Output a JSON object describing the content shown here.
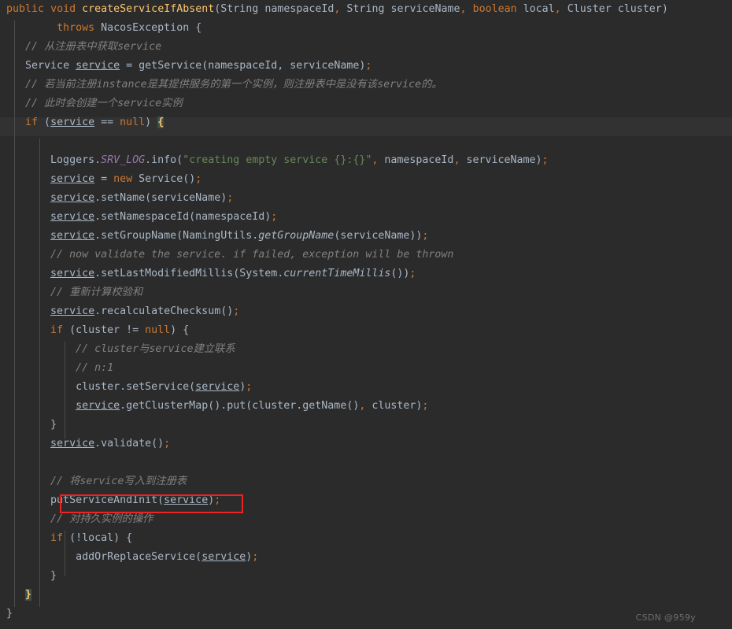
{
  "editor": {
    "language": "java",
    "theme": "darcula",
    "background_color": "#2b2b2b",
    "current_line_color": "#323232",
    "indent_guide_color": "#4b4b4b",
    "colors": {
      "keyword": "#cc7832",
      "method_declaration": "#ffc66d",
      "identifier": "#a9b7c6",
      "string": "#6a8759",
      "comment": "#808080",
      "static_field": "#9876aa",
      "matched_brace_bg": "#3b514d",
      "annotation_box": "#ee2222",
      "watermark": "#6e6e6e"
    }
  },
  "code": {
    "l1": {
      "kw_public": "public",
      "kw_void": "void",
      "method_name": "createServiceIfAbsent",
      "open_paren": "(",
      "type_string_1": "String",
      "param_namespace_id": "namespaceId",
      "comma_1": ",",
      "type_string_2": "String",
      "param_service_name": "serviceName",
      "comma_2": ",",
      "kw_boolean": "boolean",
      "param_local": "local",
      "comma_3": ",",
      "type_cluster": "Cluster",
      "param_cluster": "cluster",
      "close_paren": ")"
    },
    "l2": {
      "kw_throws": "throws",
      "exception": "NacosException",
      "brace": "{"
    },
    "l3": {
      "comment": "// 从注册表中获取service"
    },
    "l4": {
      "type": "Service",
      "var": "service",
      "assign": " = ",
      "call": "getService(namespaceId, serviceName)",
      "semi": ";"
    },
    "l5": {
      "comment": "// 若当前注册instance是其提供服务的第一个实例，则注册表中是没有该service的。"
    },
    "l6": {
      "comment": "// 此时会创建一个service实例"
    },
    "l7": {
      "kw_if": "if",
      "open": " (",
      "var": "service",
      "op": " == ",
      "kw_null": "null",
      "close": ")",
      "brace": "{"
    },
    "l8": {
      "text": ""
    },
    "l9": {
      "loggers": "Loggers.",
      "srv_log": "SRV_LOG",
      "info": ".info(",
      "string": "\"creating empty service {}:{}\"",
      "comma1": ",",
      "arg1": " namespaceId",
      "comma2": ",",
      "arg2": " serviceName)",
      "semi": ";"
    },
    "l10": {
      "var": "service",
      "assign": " = ",
      "kw_new": "new",
      "ctor": " Service()",
      "semi": ";"
    },
    "l11": {
      "var": "service",
      "call": ".setName(serviceName)",
      "semi": ";"
    },
    "l12": {
      "var": "service",
      "call": ".setNamespaceId(namespaceId)",
      "semi": ";"
    },
    "l13": {
      "var": "service",
      "call_a": ".setGroupName(NamingUtils.",
      "static_method": "getGroupName",
      "call_b": "(serviceName))",
      "semi": ";"
    },
    "l14": {
      "comment": "// now validate the service. if failed, exception will be thrown"
    },
    "l15": {
      "var": "service",
      "call_a": ".setLastModifiedMillis(System.",
      "static_method": "currentTimeMillis",
      "call_b": "())",
      "semi": ";"
    },
    "l16": {
      "comment": "// 重新计算校验和"
    },
    "l17": {
      "var": "service",
      "call": ".recalculateChecksum()",
      "semi": ";"
    },
    "l18": {
      "kw_if": "if",
      "open": " (cluster != ",
      "kw_null": "null",
      "close": ") {"
    },
    "l19": {
      "comment": "// cluster与service建立联系"
    },
    "l20": {
      "comment": "// n:1"
    },
    "l21": {
      "call_a": "cluster.setService(",
      "var": "service",
      "call_b": ")",
      "semi": ";"
    },
    "l22": {
      "var": "service",
      "call_a": ".getClusterMap().put(cluster.getName()",
      "comma": ",",
      "call_b": " cluster)",
      "semi": ";"
    },
    "l23": {
      "brace": "}"
    },
    "l24": {
      "var": "service",
      "call": ".validate()",
      "semi": ";"
    },
    "l25": {
      "text": ""
    },
    "l26": {
      "comment": "// 将service写入到注册表"
    },
    "l27": {
      "call_a": "putServiceAndInit(",
      "var": "service",
      "call_b": ")",
      "semi": ";"
    },
    "l28": {
      "comment": "// 对持久实例的操作"
    },
    "l29": {
      "kw_if": "if",
      "open": " (!local) {"
    },
    "l30": {
      "call_a": "addOrReplaceService(",
      "var": "service",
      "call_b": ")",
      "semi": ";"
    },
    "l31": {
      "brace": "}"
    },
    "l32": {
      "brace": "}"
    },
    "l33": {
      "brace": "}"
    }
  },
  "annotation": {
    "red_box_target": "putServiceAndInit(service);"
  },
  "watermark": {
    "text": "CSDN @959y"
  }
}
